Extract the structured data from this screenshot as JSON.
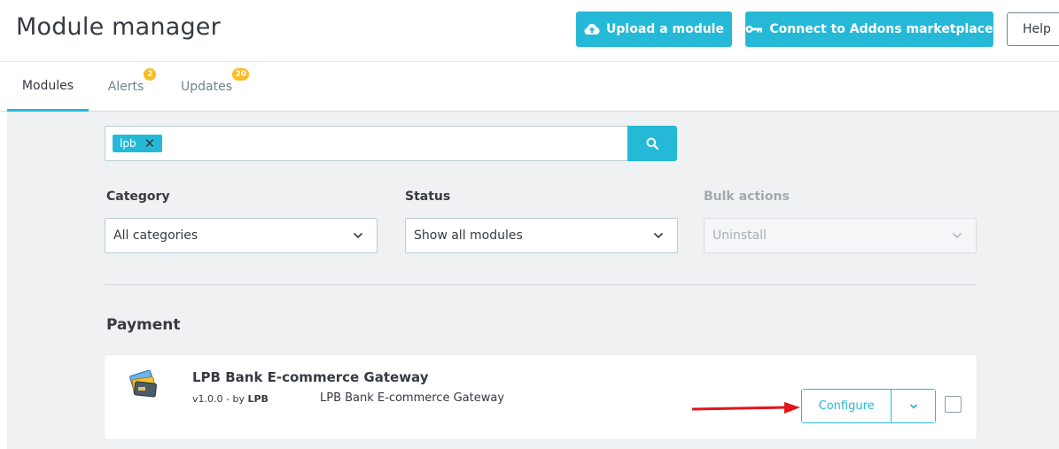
{
  "header": {
    "title": "Module manager",
    "upload_label": "Upload a module",
    "connect_label": "Connect to Addons marketplace",
    "help_label": "Help"
  },
  "tabs": [
    {
      "label": "Modules",
      "active": true
    },
    {
      "label": "Alerts",
      "badge": "2"
    },
    {
      "label": "Updates",
      "badge": "20"
    }
  ],
  "search": {
    "tag": "lpb"
  },
  "filters": {
    "category_label": "Category",
    "category_value": "All categories",
    "status_label": "Status",
    "status_value": "Show all modules",
    "bulk_label": "Bulk actions",
    "bulk_value": "Uninstall"
  },
  "section": {
    "title": "Payment"
  },
  "module": {
    "name": "LPB Bank E-commerce Gateway",
    "version": "v1.0.0 - by",
    "author": "LPB",
    "description": "LPB Bank E-commerce Gateway",
    "configure_label": "Configure"
  },
  "colors": {
    "accent": "#25b9d7",
    "badge": "#fbbb22",
    "annotation_arrow": "#e3141a"
  },
  "icons": [
    "cloud-upload-icon",
    "key-icon",
    "search-icon",
    "close-icon",
    "chevron-down-icon",
    "credit-card-icon",
    "arrow-annotation-icon"
  ]
}
